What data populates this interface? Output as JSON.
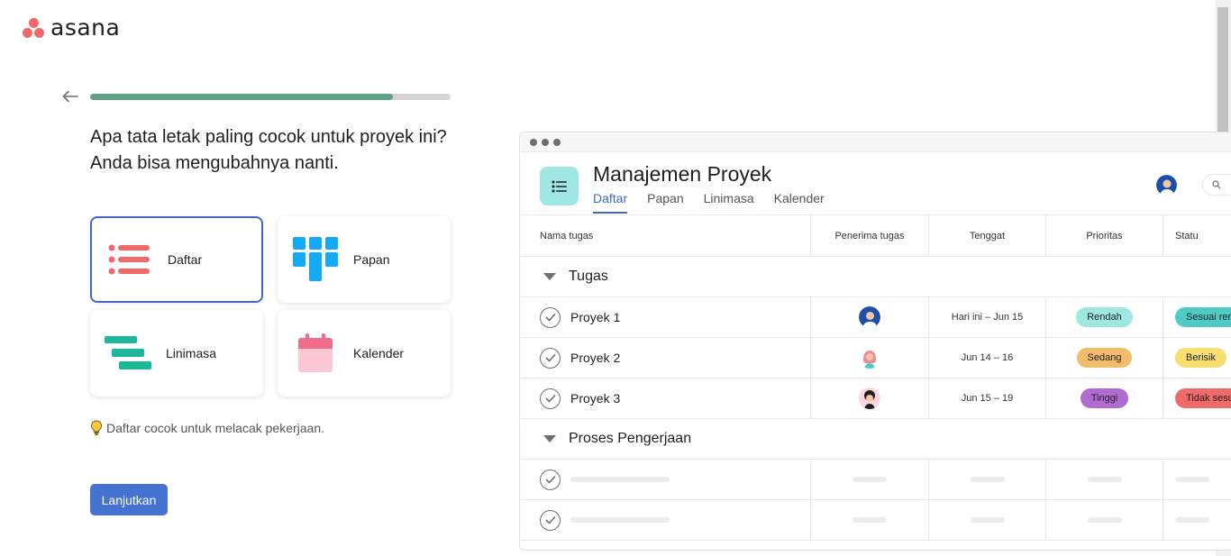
{
  "brand": {
    "name": "asana"
  },
  "nav": {
    "back_icon": "arrow-left-icon"
  },
  "progress": {
    "fraction": 0.84,
    "color": "#5da283"
  },
  "question": "Apa tata letak paling cocok untuk proyek ini? Anda bisa mengubahnya nanti.",
  "layouts": [
    {
      "label": "Daftar",
      "icon": "list-icon",
      "selected": true
    },
    {
      "label": "Papan",
      "icon": "board-icon",
      "selected": false
    },
    {
      "label": "Linimasa",
      "icon": "timeline-icon",
      "selected": false
    },
    {
      "label": "Kalender",
      "icon": "calendar-icon",
      "selected": false
    }
  ],
  "hint": {
    "icon": "lightbulb-icon",
    "text": "Daftar cocok untuk melacak pekerjaan."
  },
  "continue_label": "Lanjutkan",
  "preview": {
    "title": "Manajemen Proyek",
    "tabs": [
      "Daftar",
      "Papan",
      "Linimasa",
      "Kalender"
    ],
    "active_tab": "Daftar",
    "columns": [
      "Nama tugas",
      "Penerima tugas",
      "Tenggat",
      "Prioritas",
      "Statu"
    ],
    "sections": [
      {
        "name": "Tugas",
        "tasks": [
          {
            "name": "Proyek 1",
            "due": "Hari ini – Jun 15",
            "priority": "Rendah",
            "priority_color": "#9ee7e3",
            "status": "Sesuai ren",
            "status_color": "#4ecbc4"
          },
          {
            "name": "Proyek 2",
            "due": "Jun 14 – 16",
            "priority": "Sedang",
            "priority_color": "#f1bd6c",
            "status": "Berisik",
            "status_color": "#f8df72"
          },
          {
            "name": "Proyek 3",
            "due": "Jun 15 – 19",
            "priority": "Tinggi",
            "priority_color": "#b36bd4",
            "status": "Tidak sesuai",
            "status_color": "#f06a6a"
          }
        ]
      },
      {
        "name": "Proses Pengerjaan",
        "tasks": []
      }
    ]
  },
  "colors": {
    "accent": "#4573d2",
    "brand": "#f06a6a",
    "selected_border": "#3f6ac4"
  }
}
